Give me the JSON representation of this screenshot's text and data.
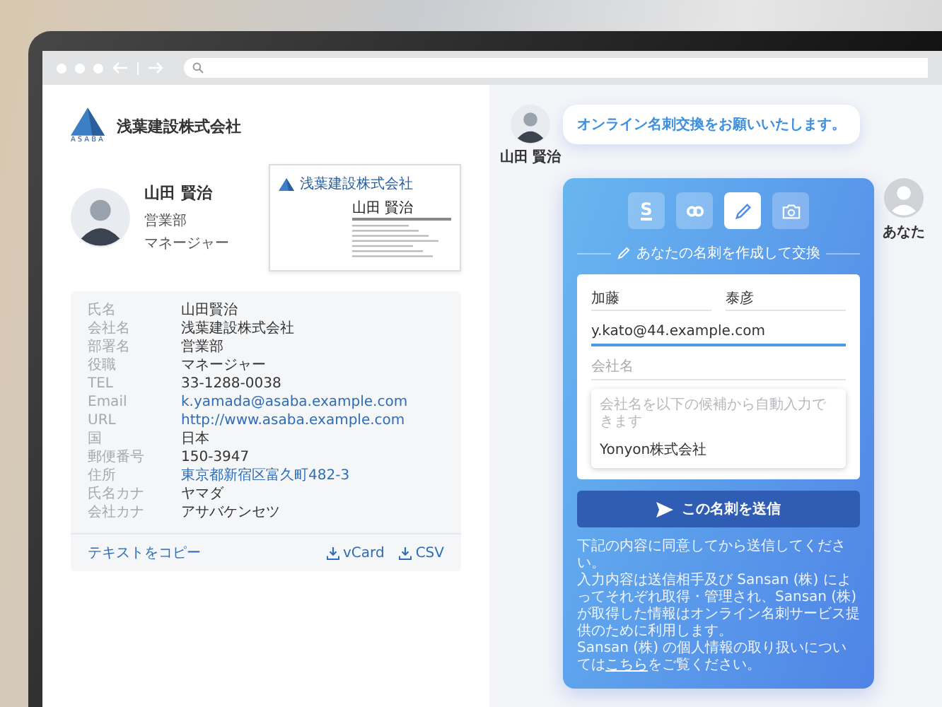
{
  "company": {
    "logo_text": "ASABA",
    "name": "浅葉建設株式会社"
  },
  "profile": {
    "name": "山田 賢治",
    "department": "営業部",
    "title": "マネージャー"
  },
  "business_card": {
    "company": "浅葉建設株式会社",
    "name": "山田 賢治"
  },
  "details": {
    "rows": [
      {
        "label": "氏名",
        "value": "山田賢治",
        "kind": "text"
      },
      {
        "label": "会社名",
        "value": "浅葉建設株式会社",
        "kind": "text"
      },
      {
        "label": "部署名",
        "value": "営業部",
        "kind": "text"
      },
      {
        "label": "役職",
        "value": "マネージャー",
        "kind": "text"
      },
      {
        "label": "TEL",
        "value": "33-1288-0038",
        "kind": "text"
      },
      {
        "label": "Email",
        "value": "k.yamada@asaba.example.com",
        "kind": "link"
      },
      {
        "label": "URL",
        "value": "http://www.asaba.example.com",
        "kind": "link"
      },
      {
        "label": "国",
        "value": "日本",
        "kind": "text"
      },
      {
        "label": "郵便番号",
        "value": "150-3947",
        "kind": "text"
      },
      {
        "label": "住所",
        "value": "東京都新宿区富久町482-3",
        "kind": "link"
      },
      {
        "label": "氏名カナ",
        "value": "ヤマダ",
        "kind": "text"
      },
      {
        "label": "会社カナ",
        "value": "アサバケンセツ",
        "kind": "text"
      }
    ],
    "copy_link": "テキストをコピー",
    "downloads": [
      "vCard",
      "CSV"
    ]
  },
  "chat": {
    "sender_name": "山田 賢治",
    "message": "オンライン名刺交換をお願いいたします。",
    "you_label": "あなた",
    "tabs": [
      {
        "kind": "logo",
        "glyph": "S",
        "selected": false
      },
      {
        "kind": "link",
        "selected": false
      },
      {
        "kind": "pencil",
        "selected": true
      },
      {
        "kind": "camera",
        "selected": false
      }
    ],
    "section_title": "あなたの名刺を作成して交換",
    "form": {
      "last_name": "加藤",
      "first_name": "泰彦",
      "email": {
        "value": "y.kato@44.example.com",
        "focused": true
      },
      "company": {
        "placeholder": "会社名"
      },
      "suggestions": {
        "hint": "会社名を以下の候補から自動入力できます",
        "items": [
          "Yonyon株式会社"
        ]
      }
    },
    "submit": "この名刺を送信",
    "notice": [
      "下記の内容に同意してから送信してください。",
      "入力内容は送信相手及び Sansan (株) によってそれぞれ取得・管理され、Sansan (株) が取得した情報はオンライン名刺サービス提供のために利用します。"
    ],
    "notice_last": {
      "before": "Sansan (株) の個人情報の取り扱いについては",
      "link": "こちら",
      "after": "をご覧ください。"
    }
  }
}
